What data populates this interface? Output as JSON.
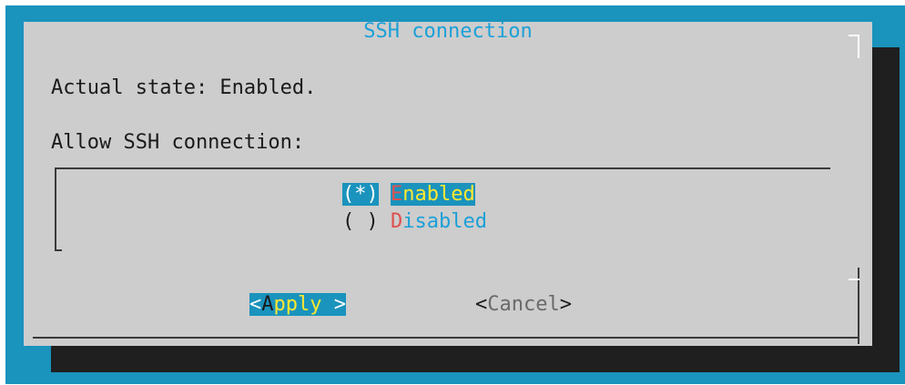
{
  "dialog": {
    "title": "SSH connection",
    "state_text": "Actual state: Enabled.",
    "prompt_text": "Allow SSH connection:"
  },
  "options": [
    {
      "marker": "(*)",
      "hotkey": "E",
      "rest": "nabled",
      "selected": true
    },
    {
      "marker": "( )",
      "hotkey": "D",
      "rest": "isabled",
      "selected": false
    }
  ],
  "buttons": {
    "apply": {
      "left_bracket": "<",
      "hotkey": "A",
      "rest": "pply",
      "right_bracket": " >"
    },
    "cancel": {
      "left_bracket": "<",
      "label": "Cancel",
      "right_bracket": ">"
    }
  },
  "colors": {
    "screen_bg": "#1a93bd",
    "dialog_bg": "#cdcdcd",
    "shadow": "#1f1f1f",
    "title": "#1ca0d8",
    "hotkey": "#e05050",
    "selected_label": "#ffe830"
  }
}
